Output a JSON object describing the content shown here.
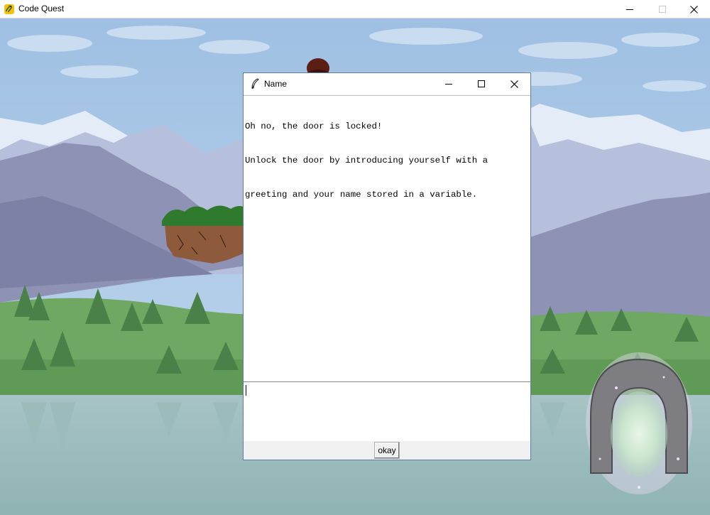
{
  "window": {
    "title": "Code Quest",
    "controls": {
      "minimize": "minimize-icon",
      "maximize": "maximize-icon",
      "close": "close-icon"
    }
  },
  "dialog": {
    "title": "Name",
    "icon": "feather-icon",
    "message_lines": [
      "Oh no, the door is locked!",
      "Unlock the door by introducing yourself with a",
      "greeting and your name stored in a variable."
    ],
    "input_value": "",
    "okay_label": "okay"
  },
  "colors": {
    "sky": "#a9c7e6",
    "mountain": "#8d8fb2",
    "grass": "#5d9e55",
    "water": "#8fb4b4",
    "dialog_border": "#5a7ea8"
  }
}
